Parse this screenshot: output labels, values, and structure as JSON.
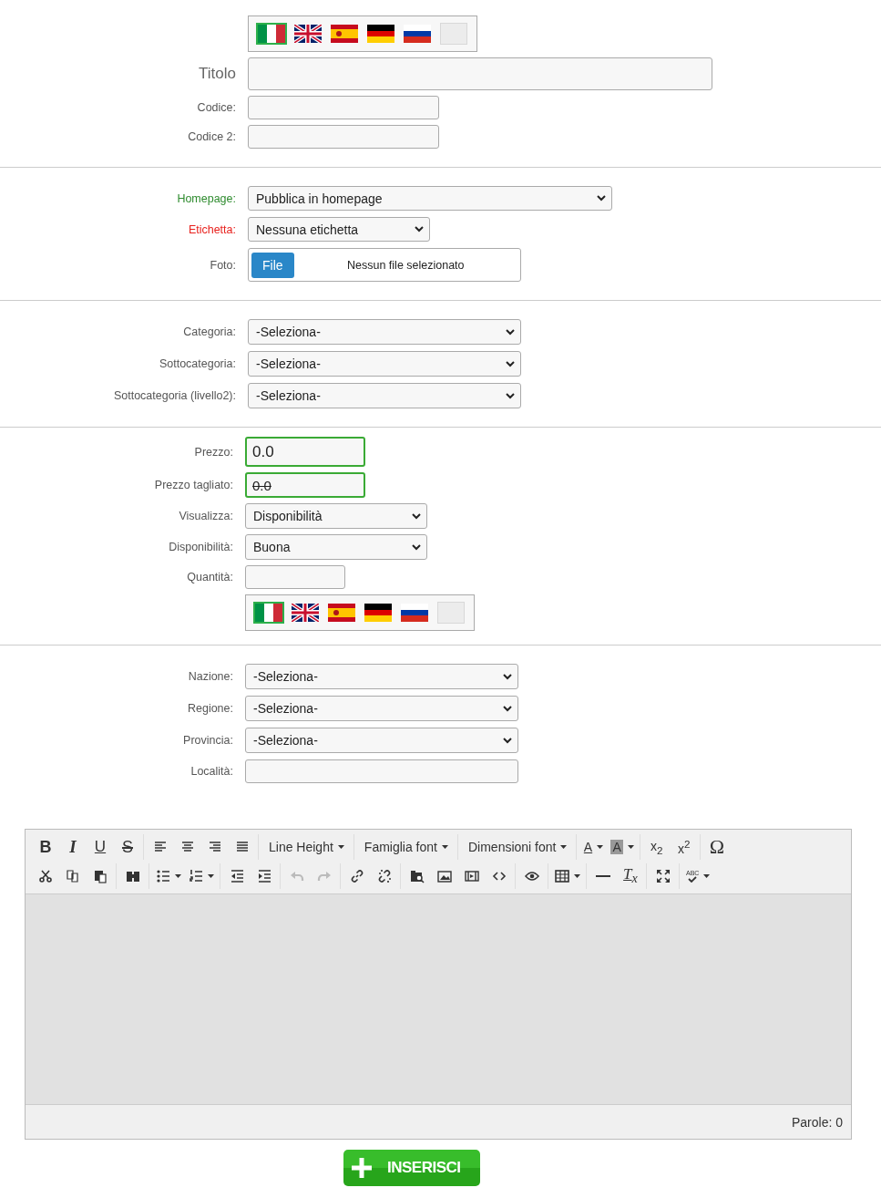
{
  "sections": [
    {
      "rows": [
        {
          "kind": "flags",
          "flags": [
            {
              "kind": "italy",
              "selected": true
            },
            {
              "kind": "uk",
              "selected": false
            },
            {
              "kind": "spain",
              "selected": false
            },
            {
              "kind": "germany",
              "selected": false
            },
            {
              "kind": "russia",
              "selected": false
            },
            {
              "kind": "blank",
              "selected": false
            }
          ]
        },
        {
          "kind": "title",
          "label": "Titolo"
        },
        {
          "kind": "text",
          "label": "Codice:"
        },
        {
          "kind": "text",
          "label": "Codice 2:"
        }
      ]
    },
    {
      "rows": [
        {
          "kind": "select",
          "label": "Homepage:",
          "color": "#2e8b2e",
          "value": "Pubblica in homepage"
        },
        {
          "kind": "select",
          "label": "Etichetta:",
          "color": "#e8201c",
          "value": "Nessuna etichetta"
        },
        {
          "kind": "file",
          "label": "Foto:",
          "button": "File",
          "status": "Nessun file selezionato"
        }
      ]
    },
    {
      "rows": [
        {
          "kind": "select",
          "label": "Categoria:",
          "value": "-Seleziona-"
        },
        {
          "kind": "select",
          "label": "Sottocategoria:",
          "value": "-Seleziona-"
        },
        {
          "kind": "select",
          "label": "Sottocategoria (livello2):",
          "value": "-Seleziona-"
        }
      ]
    },
    {
      "rows": [
        {
          "kind": "text",
          "label": "Prezzo:",
          "value": "0.0",
          "valid": true,
          "strikethrough": false
        },
        {
          "kind": "text",
          "label": "Prezzo tagliato:",
          "value": "0.0",
          "valid": true,
          "strikethrough": true
        },
        {
          "kind": "select",
          "label": "Visualizza:",
          "value": "Disponibilità"
        },
        {
          "kind": "select",
          "label": "Disponibilità:",
          "value": "Buona"
        },
        {
          "kind": "text",
          "label": "Quantità:"
        },
        {
          "kind": "flags",
          "flags": [
            {
              "kind": "italy",
              "selected": true
            },
            {
              "kind": "uk",
              "selected": false
            },
            {
              "kind": "spain",
              "selected": false
            },
            {
              "kind": "germany",
              "selected": false
            },
            {
              "kind": "russia",
              "selected": false
            },
            {
              "kind": "blank",
              "selected": false
            }
          ]
        }
      ]
    },
    {
      "rows": [
        {
          "kind": "select",
          "label": "Nazione:",
          "value": "-Seleziona-"
        },
        {
          "kind": "select",
          "label": "Regione:",
          "value": "-Seleziona-"
        },
        {
          "kind": "select",
          "label": "Provincia:",
          "value": "-Seleziona-"
        },
        {
          "kind": "text",
          "label": "Località:"
        }
      ]
    }
  ],
  "editor": {
    "toolbar": [
      [
        [
          {
            "kind": "bold",
            "label": "B",
            "menu": false,
            "disabled": false
          },
          {
            "kind": "italic",
            "label": "I",
            "menu": false,
            "disabled": false
          },
          {
            "kind": "underline",
            "label": "U",
            "menu": false,
            "disabled": false
          },
          {
            "kind": "strike",
            "label": "S",
            "menu": false,
            "disabled": false
          }
        ],
        [
          {
            "kind": "align-left",
            "menu": false,
            "disabled": false
          },
          {
            "kind": "align-center",
            "menu": false,
            "disabled": false
          },
          {
            "kind": "align-right",
            "menu": false,
            "disabled": false
          },
          {
            "kind": "justify",
            "menu": false,
            "disabled": false
          }
        ],
        [
          {
            "kind": "dropdown",
            "label": "Line Height",
            "menu": true,
            "disabled": false
          }
        ],
        [
          {
            "kind": "dropdown",
            "label": "Famiglia font",
            "menu": true,
            "disabled": false
          }
        ],
        [
          {
            "kind": "dropdown",
            "label": "Dimensioni font",
            "menu": true,
            "disabled": false
          }
        ],
        [
          {
            "kind": "text-color",
            "label": "A",
            "menu": true,
            "disabled": false
          },
          {
            "kind": "bg-color",
            "label": "A",
            "menu": true,
            "disabled": false
          }
        ],
        [
          {
            "kind": "subscript",
            "label": "x$_{2}$",
            "menu": false,
            "disabled": false
          },
          {
            "kind": "superscript",
            "label": "x$^{2}$",
            "menu": false,
            "disabled": false
          }
        ],
        [
          {
            "kind": "symbol",
            "label": "Ω",
            "menu": false,
            "disabled": false
          }
        ]
      ],
      [
        [
          {
            "kind": "cut",
            "menu": false,
            "disabled": false
          },
          {
            "kind": "copy",
            "menu": false,
            "disabled": false
          },
          {
            "kind": "paste",
            "menu": false,
            "disabled": false
          }
        ],
        [
          {
            "kind": "find",
            "menu": false,
            "disabled": false
          }
        ],
        [
          {
            "kind": "bullet-list",
            "menu": true,
            "disabled": false
          },
          {
            "kind": "number-list",
            "menu": true,
            "disabled": false
          }
        ],
        [
          {
            "kind": "outdent",
            "menu": false,
            "disabled": false
          },
          {
            "kind": "indent",
            "menu": false,
            "disabled": false
          }
        ],
        [
          {
            "kind": "undo",
            "menu": false,
            "disabled": true
          },
          {
            "kind": "redo",
            "menu": false,
            "disabled": true
          }
        ],
        [
          {
            "kind": "link",
            "menu": false,
            "disabled": false
          },
          {
            "kind": "unlink",
            "menu": false,
            "disabled": false
          }
        ],
        [
          {
            "kind": "browse",
            "menu": false,
            "disabled": false
          },
          {
            "kind": "image",
            "menu": false,
            "disabled": false
          },
          {
            "kind": "video",
            "menu": false,
            "disabled": false
          },
          {
            "kind": "source",
            "menu": false,
            "disabled": false
          }
        ],
        [
          {
            "kind": "preview",
            "menu": false,
            "disabled": false
          }
        ],
        [
          {
            "kind": "table",
            "menu": true,
            "disabled": false
          }
        ],
        [
          {
            "kind": "rule",
            "menu": false,
            "disabled": false
          },
          {
            "kind": "clear-format",
            "label": "T$_{x}$",
            "menu": false,
            "disabled": false
          }
        ],
        [
          {
            "kind": "maximize",
            "menu": false,
            "disabled": false
          }
        ],
        [
          {
            "kind": "spellcheck",
            "label": "ABC",
            "menu": true,
            "disabled": false
          }
        ]
      ]
    ],
    "word_count": "Parole: 0"
  },
  "submit": {
    "label": "INSERISCI"
  }
}
